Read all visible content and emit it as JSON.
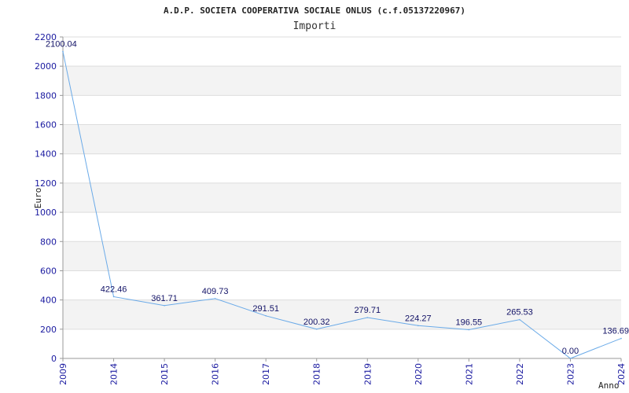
{
  "chart_data": {
    "type": "line",
    "title": "A.D.P. SOCIETA COOPERATIVA SOCIALE ONLUS (c.f.05137220967)",
    "subtitle": "Importi",
    "xlabel": "Anno",
    "ylabel": "Euro",
    "categories": [
      "2009",
      "2014",
      "2015",
      "2016",
      "2017",
      "2018",
      "2019",
      "2020",
      "2021",
      "2022",
      "2023",
      "2024"
    ],
    "values": [
      2100.04,
      422.46,
      361.71,
      409.73,
      291.51,
      200.32,
      279.71,
      224.27,
      196.55,
      265.53,
      0.0,
      136.69
    ],
    "labels": [
      "2100.04",
      "422.46",
      "361.71",
      "409.73",
      "291.51",
      "200.32",
      "279.71",
      "224.27",
      "196.55",
      "265.53",
      "0.00",
      "136.69"
    ],
    "ylim": [
      0,
      2200
    ],
    "yticks": [
      "0",
      "200",
      "400",
      "600",
      "800",
      "1000",
      "1200",
      "1400",
      "1600",
      "1800",
      "2000",
      "2200"
    ],
    "grid": true,
    "line_color": "#6aaae8",
    "band_color": "#f3f3f3",
    "grid_color": "#dddddd",
    "tick_color": "#1a1aa0"
  }
}
